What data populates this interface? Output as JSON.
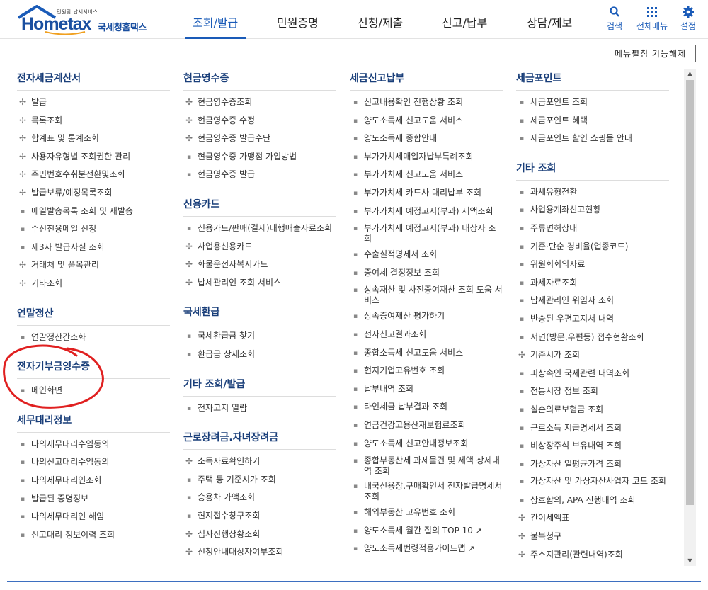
{
  "header": {
    "logo_tagline": "민원맞 납세서비스",
    "logo_brand": "Hometax",
    "logo_sub": "국세청홈택스",
    "menus": [
      "조회/발급",
      "민원증명",
      "신청/제출",
      "신고/납부",
      "상담/제보"
    ],
    "active_menu": "조회/발급",
    "utils": {
      "search": "검색",
      "allmenu": "전체메뉴",
      "settings": "설정"
    },
    "accent": "#1a5bb8"
  },
  "toggle_button": "메뉴펼침 기능해제",
  "columns": [
    {
      "sections": [
        {
          "title": "전자세금계산서",
          "items": [
            {
              "t": "발급",
              "m": "plus"
            },
            {
              "t": "목록조회",
              "m": "plus"
            },
            {
              "t": "합계표 및 통계조회",
              "m": "plus"
            },
            {
              "t": "사용자유형별 조회권한 관리",
              "m": "plus"
            },
            {
              "t": "주민번호수취분전환및조회",
              "m": "plus"
            },
            {
              "t": "발급보류/예정목록조회",
              "m": "plus"
            },
            {
              "t": "메일발송목록 조회 및 재발송",
              "m": "dot"
            },
            {
              "t": "수신전용메일 신청",
              "m": "dot"
            },
            {
              "t": "제3자 발급사실 조회",
              "m": "dot"
            },
            {
              "t": "거래처 및 품목관리",
              "m": "plus"
            },
            {
              "t": "기타조회",
              "m": "plus"
            }
          ]
        },
        {
          "title": "연말정산",
          "items": [
            {
              "t": "연말정산간소화",
              "m": "dot"
            }
          ]
        },
        {
          "title": "전자기부금영수증",
          "items": [
            {
              "t": "메인화면",
              "m": "dot"
            }
          ]
        },
        {
          "title": "세무대리정보",
          "items": [
            {
              "t": "나의세무대리수임동의",
              "m": "dot"
            },
            {
              "t": "나의신고대리수임동의",
              "m": "dot"
            },
            {
              "t": "나의세무대리인조회",
              "m": "dot"
            },
            {
              "t": "발급된 증명정보",
              "m": "dot"
            },
            {
              "t": "나의세무대리인 해임",
              "m": "dot"
            },
            {
              "t": "신고대리 정보이력 조회",
              "m": "dot"
            }
          ]
        }
      ]
    },
    {
      "sections": [
        {
          "title": "현금영수증",
          "items": [
            {
              "t": "현금영수증조회",
              "m": "plus"
            },
            {
              "t": "현금영수증 수정",
              "m": "plus"
            },
            {
              "t": "현금영수증 발급수단",
              "m": "plus"
            },
            {
              "t": "현금영수증 가맹점 가입방법",
              "m": "dot"
            },
            {
              "t": "현금영수증 발급",
              "m": "dot"
            }
          ]
        },
        {
          "title": "신용카드",
          "items": [
            {
              "t": "신용카드/판매(결제)대행매출자료조회",
              "m": "dot"
            },
            {
              "t": "사업용신용카드",
              "m": "plus"
            },
            {
              "t": "화물운전자복지카드",
              "m": "plus"
            },
            {
              "t": "납세관리인 조회 서비스",
              "m": "plus"
            }
          ]
        },
        {
          "title": "국세환급",
          "items": [
            {
              "t": "국세환급금 찾기",
              "m": "dot"
            },
            {
              "t": "환급금 상세조회",
              "m": "dot"
            }
          ]
        },
        {
          "title": "기타 조회/발급",
          "items": [
            {
              "t": "전자고지 열람",
              "m": "dot"
            }
          ]
        },
        {
          "title": "근로장려금.자녀장려금",
          "items": [
            {
              "t": "소득자료확인하기",
              "m": "plus"
            },
            {
              "t": "주택 등 기준시가 조회",
              "m": "dot"
            },
            {
              "t": "승용차 가액조회",
              "m": "dot"
            },
            {
              "t": "현지접수창구조회",
              "m": "dot"
            },
            {
              "t": "심사진행상황조회",
              "m": "plus"
            },
            {
              "t": "신청안내대상자여부조회",
              "m": "plus"
            }
          ]
        }
      ]
    },
    {
      "sections": [
        {
          "title": "세금신고납부",
          "items": [
            {
              "t": "신고내용확인 진행상황 조회",
              "m": "dot"
            },
            {
              "t": "양도소득세 신고도움 서비스",
              "m": "dot"
            },
            {
              "t": "양도소득세 종합안내",
              "m": "dot"
            },
            {
              "t": "부가가치세매입자납부특례조회",
              "m": "dot"
            },
            {
              "t": "부가가치세 신고도움 서비스",
              "m": "dot"
            },
            {
              "t": "부가가치세 카드사 대리납부 조회",
              "m": "dot"
            },
            {
              "t": "부가가치세 예정고지(부과) 세액조회",
              "m": "dot"
            },
            {
              "t": "부가가치세 예정고지(부과) 대상자 조회",
              "m": "dot",
              "wrap": true
            },
            {
              "t": "수출실적명세서 조회",
              "m": "dot"
            },
            {
              "t": "증여세 결정정보 조회",
              "m": "dot"
            },
            {
              "t": "상속재산 및 사전증여재산 조회 도움 서비스",
              "m": "dot",
              "wrap": true
            },
            {
              "t": "상속증여재산 평가하기",
              "m": "dot"
            },
            {
              "t": "전자신고결과조회",
              "m": "dot"
            },
            {
              "t": "종합소득세 신고도움 서비스",
              "m": "dot"
            },
            {
              "t": "현지기업고유번호 조회",
              "m": "dot"
            },
            {
              "t": "납부내역 조회",
              "m": "dot"
            },
            {
              "t": "타인세금 납부결과 조회",
              "m": "dot"
            },
            {
              "t": "연금건강고용산재보험료조회",
              "m": "dot"
            },
            {
              "t": "양도소득세 신고안내정보조회",
              "m": "dot"
            },
            {
              "t": "종합부동산세 과세물건 및 세액 상세내역 조회",
              "m": "dot",
              "wrap": true
            },
            {
              "t": "내국신용장.구매확인서 전자발급명세서 조회",
              "m": "dot",
              "wrap": true
            },
            {
              "t": "해외부동산 고유번호 조회",
              "m": "dot"
            },
            {
              "t": "양도소득세 월간 질의 TOP 10",
              "m": "dot",
              "ext": true
            },
            {
              "t": "양도소득세번령적용가이드맵",
              "m": "dot",
              "ext": true
            }
          ]
        }
      ]
    },
    {
      "sections": [
        {
          "title": "세금포인트",
          "items": [
            {
              "t": "세금포인트 조회",
              "m": "dot"
            },
            {
              "t": "세금포인트 혜택",
              "m": "dot"
            },
            {
              "t": "세금포인트 할인 쇼핑몰 안내",
              "m": "dot"
            }
          ]
        },
        {
          "title": "기타 조회",
          "items": [
            {
              "t": "과세유형전환",
              "m": "dot"
            },
            {
              "t": "사업용계좌신고현황",
              "m": "dot"
            },
            {
              "t": "주류면허상태",
              "m": "dot"
            },
            {
              "t": "기준·단순 경비율(업종코드)",
              "m": "dot"
            },
            {
              "t": "위원회회의자료",
              "m": "dot"
            },
            {
              "t": "과세자료조회",
              "m": "dot"
            },
            {
              "t": "납세관리인 위임자 조회",
              "m": "dot"
            },
            {
              "t": "반송된 우편고지서 내역",
              "m": "dot"
            },
            {
              "t": "서면(방문,우편등) 접수현황조회",
              "m": "dot"
            },
            {
              "t": "기준시가 조회",
              "m": "plus"
            },
            {
              "t": "피상속인 국세관련 내역조회",
              "m": "dot"
            },
            {
              "t": "전통시장 정보 조회",
              "m": "dot"
            },
            {
              "t": "실손의료보험금 조회",
              "m": "dot"
            },
            {
              "t": "근로소득 지급명세서 조회",
              "m": "dot"
            },
            {
              "t": "비상장주식 보유내역 조회",
              "m": "dot"
            },
            {
              "t": "가상자산 일평균가격 조회",
              "m": "dot"
            },
            {
              "t": "가상자산 및 가상자산사업자 코드 조회",
              "m": "dot",
              "wrap": true
            },
            {
              "t": "상호합의, APA 진행내역 조회",
              "m": "dot"
            },
            {
              "t": "간이세액표",
              "m": "plus"
            },
            {
              "t": "불복청구",
              "m": "plus"
            },
            {
              "t": "주소지관리(관련내역)조회",
              "m": "plus"
            }
          ]
        }
      ]
    }
  ]
}
